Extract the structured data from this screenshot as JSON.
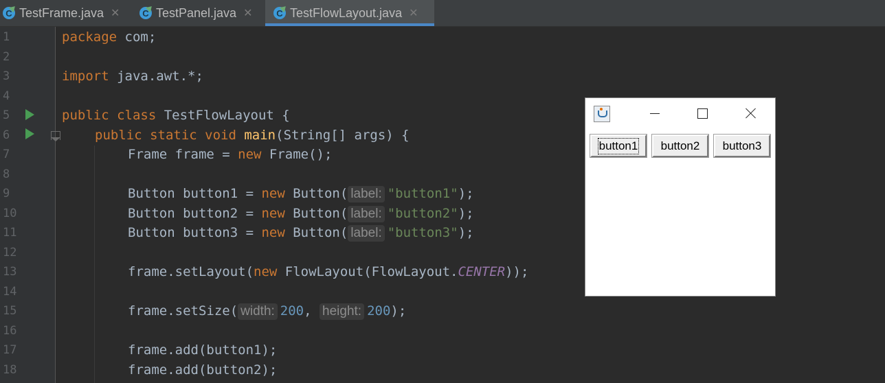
{
  "tabs": [
    {
      "label": "TestFrame.java",
      "icon": "java-class-icon"
    },
    {
      "label": "TestPanel.java",
      "icon": "java-class-icon"
    },
    {
      "label": "TestFlowLayout.java",
      "icon": "java-class-icon",
      "active": true
    }
  ],
  "line_numbers": [
    "1",
    "2",
    "3",
    "4",
    "5",
    "6",
    "7",
    "8",
    "9",
    "10",
    "11",
    "12",
    "13",
    "14",
    "15",
    "16",
    "17",
    "18"
  ],
  "code": {
    "l1_kw": "package",
    "l1_rest": " com;",
    "l3_kw": "import",
    "l3_rest": " java.awt.*;",
    "l5_kw": "public class",
    "l5_rest": " TestFlowLayout {",
    "l6_kw": "public static void",
    "l6_fn": "main",
    "l6_rest": "(String[] args) {",
    "l7_a": "Frame frame = ",
    "l7_kw": "new",
    "l7_b": " Frame();",
    "l9_a": "Button button1 = ",
    "l9_kw": "new",
    "l9_b": " Button(",
    "l9_hint": "label:",
    "l9_str": "\"button1\"",
    "l9_c": ");",
    "l10_a": "Button button2 = ",
    "l10_kw": "new",
    "l10_b": " Button(",
    "l10_hint": "label:",
    "l10_str": "\"button2\"",
    "l10_c": ");",
    "l11_a": "Button button3 = ",
    "l11_kw": "new",
    "l11_b": " Button(",
    "l11_hint": "label:",
    "l11_str": "\"button3\"",
    "l11_c": ");",
    "l13_a": "frame.setLayout(",
    "l13_kw": "new",
    "l13_b": " FlowLayout(FlowLayout.",
    "l13_const": "CENTER",
    "l13_c": "));",
    "l15_a": "frame.setSize(",
    "l15_hint1": "width:",
    "l15_num1": "200",
    "l15_sep": ",",
    "l15_hint2": "height:",
    "l15_num2": "200",
    "l15_c": ");",
    "l17": "frame.add(button1);",
    "l18": "frame.add(button2);"
  },
  "awt_window": {
    "buttons": [
      "button1",
      "button2",
      "button3"
    ]
  }
}
